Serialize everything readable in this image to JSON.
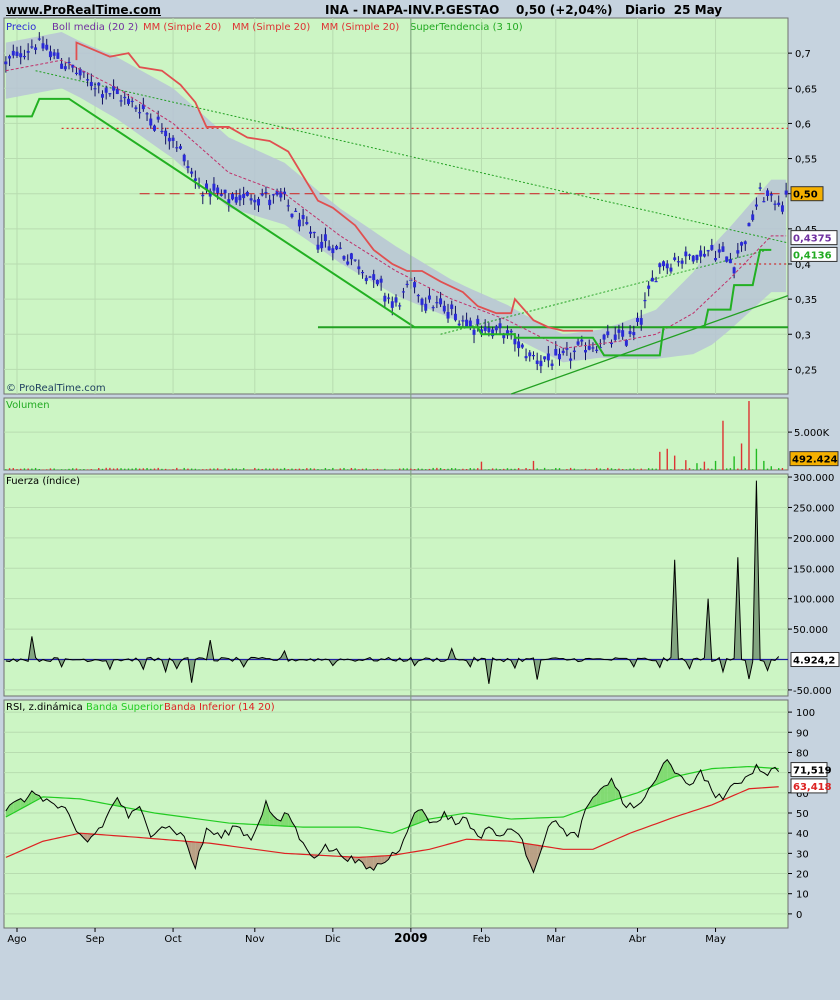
{
  "header": {
    "site": "www.ProRealTime.com",
    "title": "INA - INAPA-INV.P.GESTAO    0,50 (+2,04%)   Diario  25 May"
  },
  "colors": {
    "panel_bg": "#ccf5c4",
    "candle": "#2a2ad6",
    "bollinger_band": "#b7c3d6",
    "bollinger_mid": "#c0306a",
    "ma_red": "#e05050",
    "supertrend": "#22b022",
    "support_line": "#22a022",
    "volume_green": "#22bb22",
    "volume_red": "#dd3333",
    "fuerza_fill": "#6a8a6a",
    "rsi_line": "#000000",
    "rsi_upper": "#22cc22",
    "rsi_lower": "#dd2222"
  },
  "chart_data": [
    {
      "type": "candlestick",
      "panel": "price",
      "legend": [
        "Precio",
        "Boll media (20 2)",
        "MM (Simple 20)",
        "MM (Simple 20)",
        "MM (Simple 20)",
        "SuperTendencia (3 10)"
      ],
      "watermark": "© ProRealTime.com",
      "yticks": [
        "0,7",
        "0,65",
        "0,6",
        "0,55",
        "0,5",
        "0,45",
        "0,4",
        "0,35",
        "0,3",
        "0,25"
      ],
      "ylim": [
        0.215,
        0.75
      ],
      "x_months": [
        "Ago",
        "Sep",
        "Oct",
        "Nov",
        "Dic",
        "2009",
        "Feb",
        "Mar",
        "Abr",
        "May"
      ],
      "x_month_index": [
        3,
        24,
        45,
        67,
        88,
        109,
        128,
        148,
        170,
        191
      ],
      "n_bars": 211,
      "price_anchors": [
        [
          0,
          0.685
        ],
        [
          8,
          0.715
        ],
        [
          15,
          0.69
        ],
        [
          22,
          0.66
        ],
        [
          30,
          0.64
        ],
        [
          37,
          0.62
        ],
        [
          45,
          0.58
        ],
        [
          52,
          0.51
        ],
        [
          60,
          0.49
        ],
        [
          67,
          0.5
        ],
        [
          75,
          0.49
        ],
        [
          82,
          0.44
        ],
        [
          90,
          0.42
        ],
        [
          97,
          0.39
        ],
        [
          105,
          0.34
        ],
        [
          109,
          0.37
        ],
        [
          113,
          0.35
        ],
        [
          120,
          0.33
        ],
        [
          128,
          0.31
        ],
        [
          135,
          0.3
        ],
        [
          141,
          0.27
        ],
        [
          148,
          0.26
        ],
        [
          155,
          0.28
        ],
        [
          162,
          0.29
        ],
        [
          169,
          0.3
        ],
        [
          176,
          0.4
        ],
        [
          183,
          0.41
        ],
        [
          190,
          0.42
        ],
        [
          196,
          0.405
        ],
        [
          200,
          0.45
        ],
        [
          203,
          0.5
        ],
        [
          206,
          0.49
        ]
      ],
      "bollinger_mid_anchors": [
        [
          0,
          0.675
        ],
        [
          15,
          0.69
        ],
        [
          30,
          0.65
        ],
        [
          45,
          0.6
        ],
        [
          60,
          0.53
        ],
        [
          75,
          0.5
        ],
        [
          90,
          0.44
        ],
        [
          105,
          0.39
        ],
        [
          120,
          0.35
        ],
        [
          135,
          0.32
        ],
        [
          150,
          0.28
        ],
        [
          165,
          0.29
        ],
        [
          175,
          0.3
        ],
        [
          185,
          0.33
        ],
        [
          195,
          0.38
        ],
        [
          206,
          0.44
        ]
      ],
      "bollinger_width_anchors": [
        [
          0,
          0.04
        ],
        [
          20,
          0.04
        ],
        [
          45,
          0.05
        ],
        [
          60,
          0.05
        ],
        [
          85,
          0.04
        ],
        [
          105,
          0.035
        ],
        [
          125,
          0.025
        ],
        [
          140,
          0.02
        ],
        [
          160,
          0.02
        ],
        [
          175,
          0.035
        ],
        [
          190,
          0.07
        ],
        [
          206,
          0.08
        ]
      ],
      "ma_red_anchors": [
        [
          19,
          0.69
        ],
        [
          19,
          0.715
        ],
        [
          28,
          0.695
        ],
        [
          33,
          0.7
        ],
        [
          36,
          0.68
        ],
        [
          42,
          0.675
        ],
        [
          47,
          0.655
        ],
        [
          51,
          0.63
        ],
        [
          54,
          0.595
        ],
        [
          60,
          0.595
        ],
        [
          65,
          0.58
        ],
        [
          71,
          0.575
        ],
        [
          76,
          0.56
        ],
        [
          80,
          0.525
        ],
        [
          84,
          0.49
        ],
        [
          88,
          0.48
        ],
        [
          94,
          0.455
        ],
        [
          99,
          0.42
        ],
        [
          104,
          0.4
        ],
        [
          108,
          0.39
        ],
        [
          112,
          0.39
        ],
        [
          117,
          0.375
        ],
        [
          123,
          0.36
        ],
        [
          127,
          0.34
        ],
        [
          132,
          0.33
        ],
        [
          136,
          0.33
        ],
        [
          137,
          0.35
        ],
        [
          142,
          0.32
        ],
        [
          146,
          0.31
        ],
        [
          150,
          0.305
        ],
        [
          158,
          0.305
        ]
      ],
      "supertrend_anchors": [
        [
          0,
          0.61
        ],
        [
          7,
          0.61
        ],
        [
          9,
          0.635
        ],
        [
          17,
          0.635
        ],
        [
          110,
          0.31
        ],
        [
          127,
          0.31
        ],
        [
          128,
          0.3
        ],
        [
          137,
          0.3
        ],
        [
          137,
          0.295
        ],
        [
          158,
          0.295
        ],
        [
          161,
          0.27
        ],
        [
          176,
          0.27
        ],
        [
          177,
          0.31
        ],
        [
          188,
          0.31
        ],
        [
          189,
          0.335
        ],
        [
          195,
          0.335
        ],
        [
          196,
          0.37
        ],
        [
          201,
          0.37
        ],
        [
          203,
          0.42
        ],
        [
          206,
          0.42
        ]
      ],
      "dashed_levels": [
        {
          "value": 0.593,
          "x_start": 15,
          "color": "#dd3333",
          "style": "dotted"
        },
        {
          "value": 0.5,
          "x_start": 36,
          "color": "#cc3333",
          "style": "dashed"
        },
        {
          "value": 0.4,
          "x_start": 196,
          "color": "#cc3333",
          "style": "dotted"
        }
      ],
      "trend_lines": [
        {
          "from": [
            8,
            0.675
          ],
          "to": [
            211,
            0.43
          ],
          "style": "dotted"
        },
        {
          "from": [
            117,
            0.3
          ],
          "to": [
            205,
            0.42
          ],
          "style": "dotted"
        },
        {
          "from": [
            136,
            0.215
          ],
          "to": [
            211,
            0.355
          ],
          "style": "solid"
        }
      ],
      "support_line": {
        "value": 0.31,
        "x_start": 84
      },
      "labels": [
        {
          "value": 0.5,
          "text": "0,50",
          "bg": "#f5b000",
          "fg": "#000000"
        },
        {
          "value": 0.4375,
          "text": "0,4375",
          "bg": "#ffffff",
          "fg": "#7030a0"
        },
        {
          "value": 0.4136,
          "text": "0,4136",
          "bg": "#ffffff",
          "fg": "#22aa22"
        }
      ]
    },
    {
      "type": "bar",
      "panel": "volume",
      "title": "Volumen",
      "yticks": [
        "5.000K"
      ],
      "tick_value": 5000,
      "ymax": 9500,
      "last_label": "492.424",
      "base_volume": 160,
      "spikes": [
        [
          176,
          2400
        ],
        [
          178,
          2800
        ],
        [
          180,
          1900
        ],
        [
          183,
          1300
        ],
        [
          186,
          900
        ],
        [
          188,
          1100
        ],
        [
          191,
          1200
        ],
        [
          193,
          6500
        ],
        [
          196,
          1800
        ],
        [
          198,
          3500
        ],
        [
          200,
          9100
        ],
        [
          202,
          2800
        ],
        [
          204,
          1200
        ],
        [
          206,
          500
        ],
        [
          128,
          1100
        ],
        [
          142,
          1200
        ]
      ]
    },
    {
      "type": "area",
      "panel": "fuerza",
      "title": "Fuerza (índice)",
      "yticks": [
        "300.000",
        "250.000",
        "200.000",
        "150.000",
        "100.000",
        "50.000",
        "0",
        "-50.000"
      ],
      "ylim": [
        -60000,
        305000
      ],
      "last_label": "4.924,2",
      "noise_amplitude": 7000,
      "spikes": [
        [
          7,
          38000
        ],
        [
          15,
          -12000
        ],
        [
          28,
          -16000
        ],
        [
          37,
          -16000
        ],
        [
          43,
          -20000
        ],
        [
          46,
          -15000
        ],
        [
          50,
          -38000
        ],
        [
          55,
          32000
        ],
        [
          64,
          -12000
        ],
        [
          75,
          14000
        ],
        [
          88,
          -10000
        ],
        [
          110,
          -10000
        ],
        [
          120,
          18000
        ],
        [
          125,
          -12000
        ],
        [
          130,
          -40000
        ],
        [
          137,
          -14000
        ],
        [
          143,
          -33000
        ],
        [
          169,
          -12000
        ],
        [
          176,
          -13000
        ],
        [
          180,
          164000
        ],
        [
          184,
          -15000
        ],
        [
          189,
          100000
        ],
        [
          193,
          -20000
        ],
        [
          197,
          168000
        ],
        [
          200,
          -32000
        ],
        [
          202,
          294000
        ],
        [
          205,
          -18000
        ],
        [
          208,
          5000
        ]
      ]
    },
    {
      "type": "line",
      "panel": "rsi",
      "title": "RSI, z.dinámica",
      "legend": [
        "Banda Superior",
        "Banda Inferior (14 20)"
      ],
      "yticks": [
        "100",
        "90",
        "80",
        "70",
        "60",
        "50",
        "40",
        "30",
        "20",
        "10",
        "0"
      ],
      "ylim": [
        -7,
        106
      ],
      "rsi_anchors": [
        [
          0,
          52
        ],
        [
          4,
          56
        ],
        [
          8,
          60
        ],
        [
          12,
          55
        ],
        [
          16,
          51
        ],
        [
          19,
          40
        ],
        [
          22,
          36
        ],
        [
          26,
          44
        ],
        [
          30,
          58
        ],
        [
          33,
          48
        ],
        [
          36,
          52
        ],
        [
          39,
          40
        ],
        [
          42,
          44
        ],
        [
          45,
          42
        ],
        [
          48,
          38
        ],
        [
          51,
          23
        ],
        [
          54,
          42
        ],
        [
          58,
          38
        ],
        [
          62,
          44
        ],
        [
          66,
          37
        ],
        [
          70,
          55
        ],
        [
          73,
          45
        ],
        [
          76,
          50
        ],
        [
          80,
          34
        ],
        [
          83,
          29
        ],
        [
          86,
          33
        ],
        [
          90,
          30
        ],
        [
          94,
          26
        ],
        [
          98,
          22
        ],
        [
          102,
          26
        ],
        [
          106,
          33
        ],
        [
          109,
          47
        ],
        [
          112,
          52
        ],
        [
          115,
          44
        ],
        [
          118,
          50
        ],
        [
          121,
          45
        ],
        [
          124,
          48
        ],
        [
          127,
          37
        ],
        [
          130,
          44
        ],
        [
          133,
          37
        ],
        [
          136,
          44
        ],
        [
          139,
          35
        ],
        [
          142,
          22
        ],
        [
          145,
          38
        ],
        [
          148,
          48
        ],
        [
          151,
          38
        ],
        [
          154,
          40
        ],
        [
          157,
          55
        ],
        [
          160,
          60
        ],
        [
          163,
          68
        ],
        [
          166,
          55
        ],
        [
          169,
          52
        ],
        [
          172,
          58
        ],
        [
          175,
          66
        ],
        [
          178,
          78
        ],
        [
          181,
          68
        ],
        [
          184,
          62
        ],
        [
          187,
          72
        ],
        [
          190,
          60
        ],
        [
          193,
          58
        ],
        [
          196,
          63
        ],
        [
          199,
          68
        ],
        [
          202,
          73
        ],
        [
          205,
          70
        ],
        [
          208,
          72
        ]
      ],
      "upper_anchors": [
        [
          0,
          48
        ],
        [
          10,
          58
        ],
        [
          20,
          57
        ],
        [
          40,
          50
        ],
        [
          60,
          45
        ],
        [
          80,
          43
        ],
        [
          95,
          43
        ],
        [
          104,
          40
        ],
        [
          114,
          47
        ],
        [
          124,
          50
        ],
        [
          136,
          47
        ],
        [
          150,
          48
        ],
        [
          156,
          52
        ],
        [
          170,
          60
        ],
        [
          180,
          68
        ],
        [
          190,
          72
        ],
        [
          200,
          73
        ],
        [
          208,
          72
        ]
      ],
      "lower_anchors": [
        [
          0,
          28
        ],
        [
          10,
          36
        ],
        [
          20,
          40
        ],
        [
          35,
          38
        ],
        [
          55,
          35
        ],
        [
          75,
          30
        ],
        [
          95,
          28
        ],
        [
          104,
          29
        ],
        [
          114,
          32
        ],
        [
          124,
          37
        ],
        [
          136,
          36
        ],
        [
          150,
          32
        ],
        [
          158,
          32
        ],
        [
          168,
          40
        ],
        [
          180,
          48
        ],
        [
          190,
          54
        ],
        [
          200,
          62
        ],
        [
          208,
          63
        ]
      ],
      "last_labels": [
        {
          "value": 71.519,
          "text": "71,519",
          "bg": "#ffffff",
          "fg": "#000000"
        },
        {
          "value": 63.418,
          "text": "63,418",
          "bg": "#ffffff",
          "fg": "#dd2222"
        }
      ]
    }
  ]
}
